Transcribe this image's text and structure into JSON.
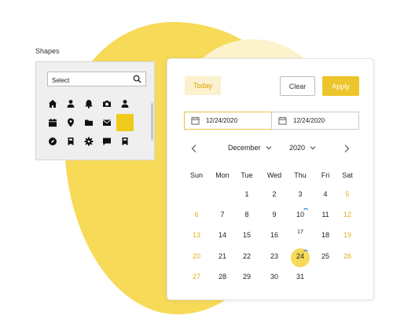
{
  "colors": {
    "accent": "#ECC52B",
    "blob": "#F6DA58",
    "blob_light": "#FCF3CD",
    "weekend": "#E0B121",
    "event": "#3B8BD9"
  },
  "shapes_panel": {
    "title": "Shapes",
    "search_placeholder": "Select",
    "icons": [
      [
        "home-icon",
        "person-icon",
        "bell-icon",
        "camera-icon",
        "person-icon"
      ],
      [
        "calendar-icon",
        "location-pin-icon",
        "folder-icon",
        "mail-icon",
        "selected-swatch"
      ],
      [
        "compass-icon",
        "bookmark-icon",
        "gear-icon",
        "chat-icon",
        "bookmark-icon"
      ]
    ]
  },
  "datepicker": {
    "today_label": "Today",
    "clear_label": "Clear",
    "apply_label": "Apply",
    "start_date": "12/24/2020",
    "end_date": "12/24/2020",
    "month": "December",
    "year": "2020",
    "weekdays": [
      "Sun",
      "Mon",
      "Tue",
      "Wed",
      "Thu",
      "Fri",
      "Sat"
    ],
    "weeks": [
      [
        "",
        "",
        "1",
        "2",
        "3",
        "4",
        "5"
      ],
      [
        "6",
        "7",
        "8",
        "9",
        "10",
        "11",
        "12"
      ],
      [
        "13",
        "14",
        "15",
        "16",
        "17",
        "18",
        "19"
      ],
      [
        "20",
        "21",
        "22",
        "23",
        "24",
        "25",
        "26"
      ],
      [
        "27",
        "28",
        "29",
        "30",
        "31",
        "",
        ""
      ]
    ],
    "selected_day": "24",
    "event_days": [
      "10",
      "24"
    ],
    "small_days": [
      "17"
    ]
  }
}
